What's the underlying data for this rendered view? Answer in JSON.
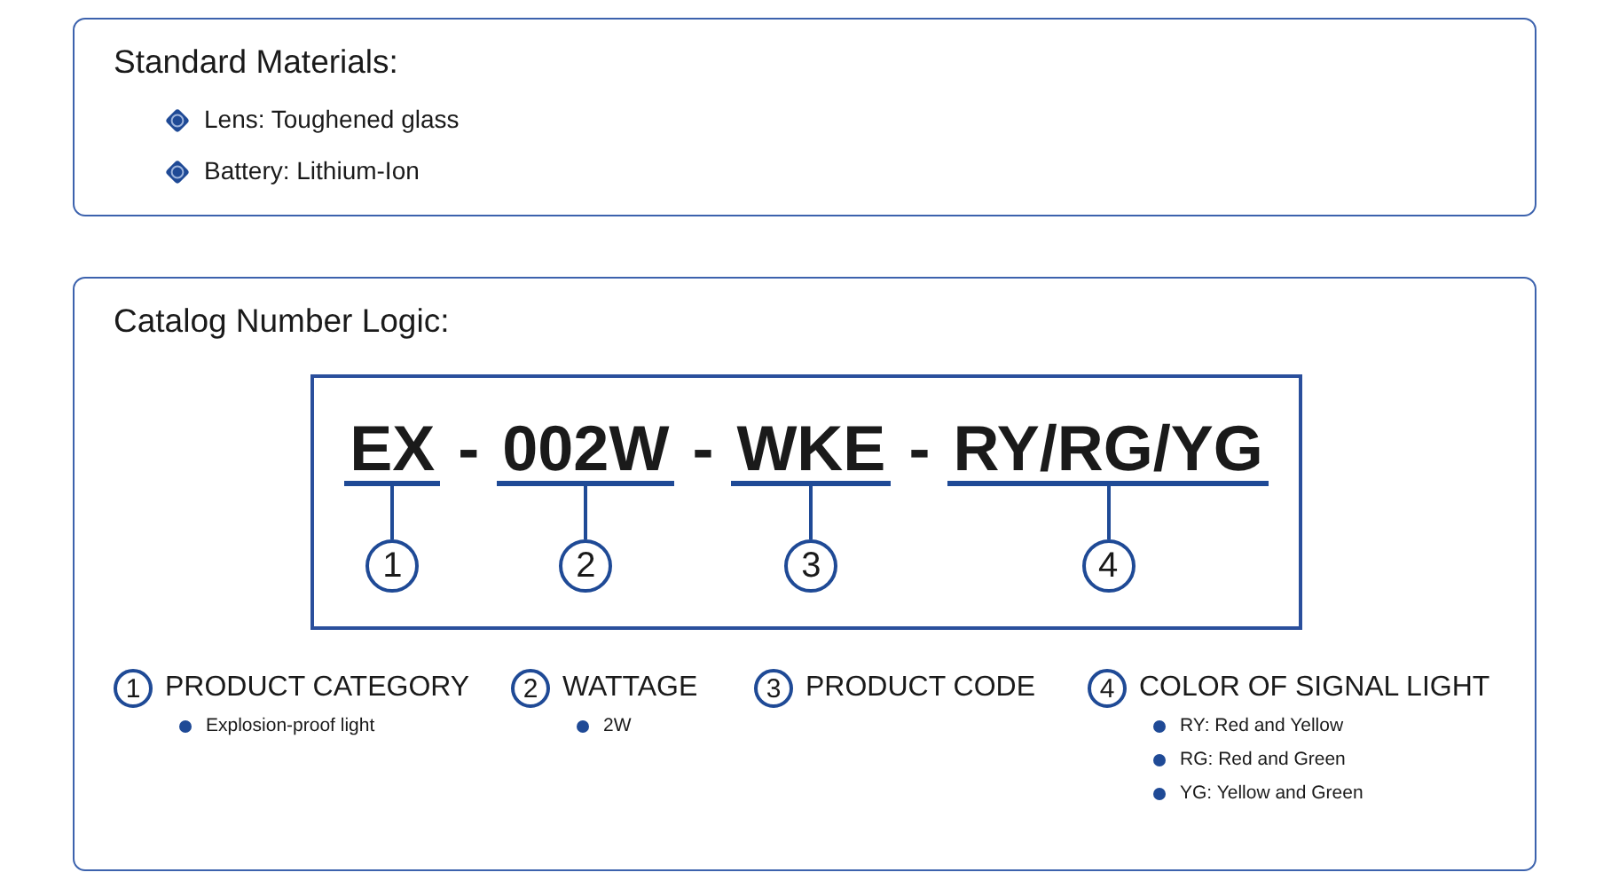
{
  "materials": {
    "title": "Standard Materials:",
    "items": [
      "Lens: Toughened glass",
      "Battery: Lithium-Ion"
    ]
  },
  "catalog": {
    "title": "Catalog Number Logic:",
    "segments": [
      {
        "code": "EX",
        "number": "1",
        "separator": "-"
      },
      {
        "code": "002W",
        "number": "2",
        "separator": "-"
      },
      {
        "code": "WKE",
        "number": "3",
        "separator": "-"
      },
      {
        "code": "RY/RG/YG",
        "number": "4"
      }
    ],
    "legend": [
      {
        "number": "1",
        "heading": "PRODUCT CATEGORY",
        "items": [
          "Explosion-proof light"
        ]
      },
      {
        "number": "2",
        "heading": "WATTAGE",
        "items": [
          "2W"
        ]
      },
      {
        "number": "3",
        "heading": "PRODUCT CODE"
      },
      {
        "number": "4",
        "heading": "COLOR OF SIGNAL LIGHT",
        "items": [
          "RY: Red and Yellow",
          "RG: Red and Green",
          "YG: Yellow and Green"
        ]
      }
    ]
  }
}
